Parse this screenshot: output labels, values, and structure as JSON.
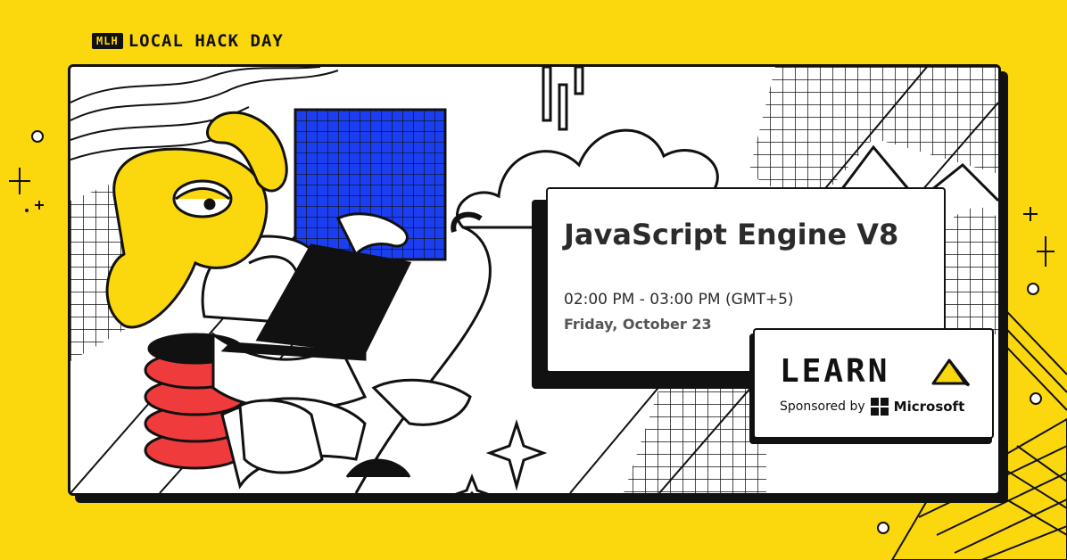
{
  "logo": {
    "mlh": "MLH",
    "brand": "LOCAL HACK DAY"
  },
  "event": {
    "title": "JavaScript Engine V8",
    "time": "02:00 PM - 03:00 PM (GMT+5)",
    "date": "Friday, October 23"
  },
  "learn": {
    "word": "LEARN",
    "sponsored_by": "Sponsored by",
    "sponsor_name": "Microsoft"
  },
  "colors": {
    "background": "#fbd70e",
    "accent_blue": "#1b3ef0",
    "mascot_yellow": "#fbd70e",
    "cushion_red": "#ef3b3b",
    "ink": "#111111"
  },
  "icons": [
    "mascot-illustration",
    "laptop-icon",
    "blue-grid-icon",
    "cloud-icon",
    "sparkle-icon",
    "microsoft-logo-icon",
    "learn-triangle-icon"
  ]
}
